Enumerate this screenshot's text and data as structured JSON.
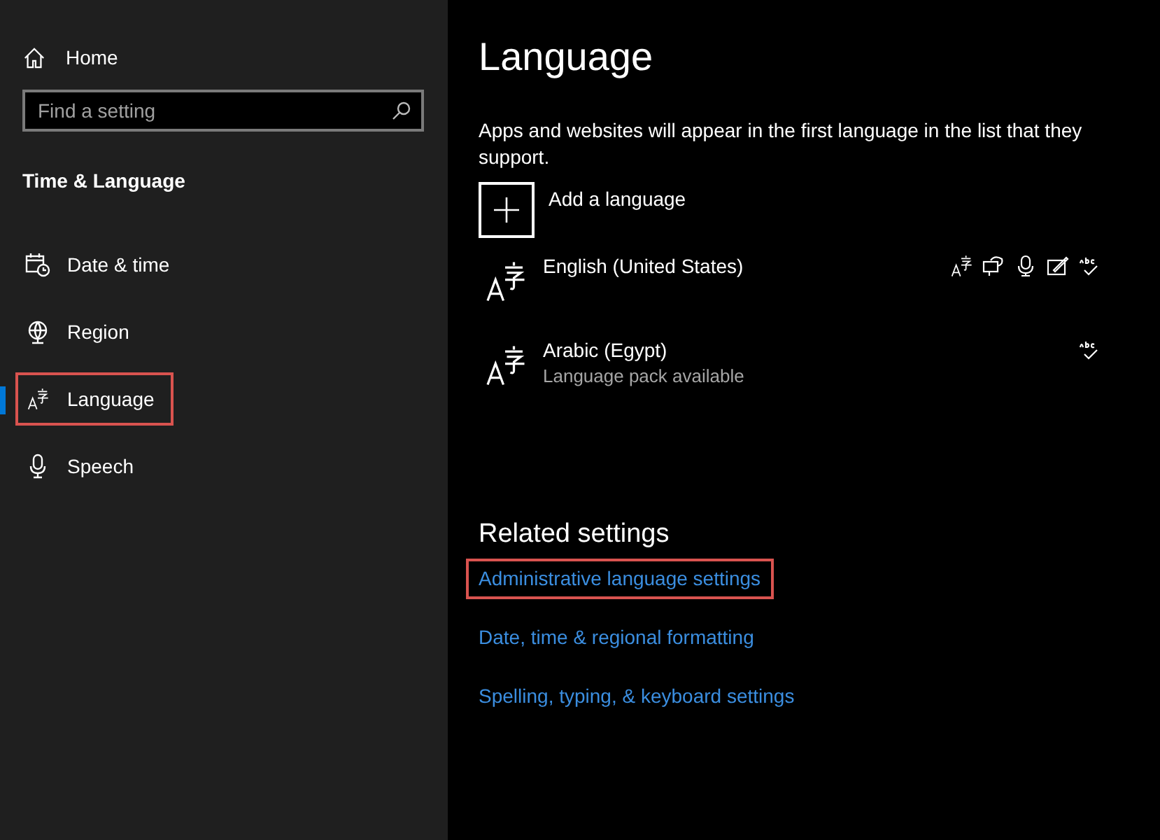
{
  "sidebar": {
    "home": "Home",
    "search": {
      "placeholder": "Find a setting"
    },
    "section_title": "Time & Language",
    "items": [
      {
        "label": "Date & time",
        "kind": "calendar-clock",
        "selected": false,
        "highlighted": false
      },
      {
        "label": "Region",
        "kind": "globe",
        "selected": false,
        "highlighted": false
      },
      {
        "label": "Language",
        "kind": "language",
        "selected": true,
        "highlighted": true
      },
      {
        "label": "Speech",
        "kind": "microphone",
        "selected": false,
        "highlighted": false
      }
    ]
  },
  "main": {
    "title": "Language",
    "description": "Apps and websites will appear in the first language in the list that they support.",
    "add_language": "Add a language",
    "languages": [
      {
        "name": "English (United States)",
        "features": [
          {
            "kind": "language"
          },
          {
            "kind": "speech"
          },
          {
            "kind": "microphone"
          },
          {
            "kind": "handwriting"
          },
          {
            "kind": "spelling"
          }
        ]
      },
      {
        "name": "Arabic (Egypt)",
        "status": "Language pack available",
        "features": [
          {
            "kind": "spelling"
          }
        ]
      }
    ],
    "related_title": "Related settings",
    "related_links": [
      {
        "label": "Administrative language settings",
        "highlighted": true
      },
      {
        "label": "Date, time & regional formatting",
        "highlighted": false
      },
      {
        "label": "Spelling, typing, & keyboard settings",
        "highlighted": false
      }
    ]
  }
}
